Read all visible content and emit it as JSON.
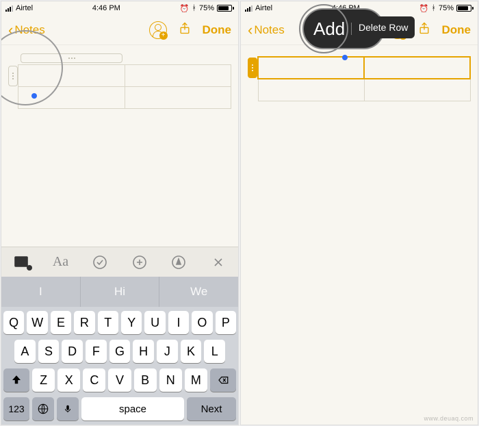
{
  "status": {
    "carrier": "Airtel",
    "time": "4:46 PM",
    "battery_pct": "75%"
  },
  "nav": {
    "back_label": "Notes",
    "done_label": "Done"
  },
  "context_menu": {
    "add_row": "Add R",
    "delete_row": "Delete Row"
  },
  "format_bar": {
    "aa": "Aa"
  },
  "predictive": {
    "s1": "I",
    "s2": "Hi",
    "s3": "We"
  },
  "keyboard": {
    "r1": [
      "Q",
      "W",
      "E",
      "R",
      "T",
      "Y",
      "U",
      "I",
      "O",
      "P"
    ],
    "r2": [
      "A",
      "S",
      "D",
      "F",
      "G",
      "H",
      "J",
      "K",
      "L"
    ],
    "r3": [
      "Z",
      "X",
      "C",
      "V",
      "B",
      "N",
      "M"
    ],
    "mode": "123",
    "space": "space",
    "next": "Next"
  },
  "watermark": "www.deuaq.com"
}
